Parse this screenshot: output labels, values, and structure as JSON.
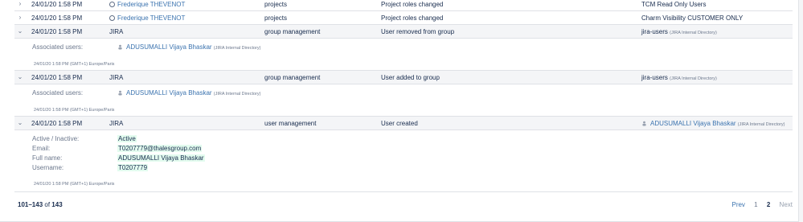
{
  "rows": [
    {
      "chevron": "›",
      "date": "24/01/20 1:58 PM",
      "author": "Frederique THEVENOT",
      "category": "projects",
      "summary": "Project roles changed",
      "object": "TCM Read Only Users"
    },
    {
      "chevron": "›",
      "date": "24/01/20 1:58 PM",
      "author": "Frederique THEVENOT",
      "category": "projects",
      "summary": "Project roles changed",
      "object": "Charm Visibility CUSTOMER ONLY"
    },
    {
      "chevron": "⌄",
      "date": "24/01/20 1:58 PM",
      "author": "JIRA",
      "category": "group management",
      "summary": "User removed from group",
      "object": "jira-users",
      "object_note": "(JIRA Internal Directory)",
      "assoc_label": "Associated users:",
      "assoc_user": "ADUSUMALLI Vijaya Bhaskar",
      "assoc_note": "(JIRA Internal Directory)",
      "timestamp": "24/01/20 1:58 PM (GMT+1) Europe/Paris"
    },
    {
      "chevron": "⌄",
      "date": "24/01/20 1:58 PM",
      "author": "JIRA",
      "category": "group management",
      "summary": "User added to group",
      "object": "jira-users",
      "object_note": "(JIRA Internal Directory)",
      "assoc_label": "Associated users:",
      "assoc_user": "ADUSUMALLI Vijaya Bhaskar",
      "assoc_note": "(JIRA Internal Directory)",
      "timestamp": "24/01/20 1:58 PM (GMT+1) Europe/Paris"
    },
    {
      "chevron": "⌄",
      "date": "24/01/20 1:58 PM",
      "author": "JIRA",
      "category": "user management",
      "summary": "User created",
      "object": "ADUSUMALLI Vijaya Bhaskar",
      "object_note": "(JIRA Internal Directory)",
      "fields": [
        {
          "label": "Active / Inactive:",
          "value": "Active"
        },
        {
          "label": "Email:",
          "value": "T0207779@thalesgroup.com"
        },
        {
          "label": "Full name:",
          "value": "ADUSUMALLI Vijaya Bhaskar"
        },
        {
          "label": "Username:",
          "value": "T0207779"
        }
      ],
      "timestamp": "24/01/20 1:58 PM (GMT+1) Europe/Paris"
    }
  ],
  "footer": {
    "range": "101–143",
    "of": "of",
    "total": "143",
    "prev": "Prev",
    "page1": "1",
    "page2": "2",
    "next": "Next"
  }
}
